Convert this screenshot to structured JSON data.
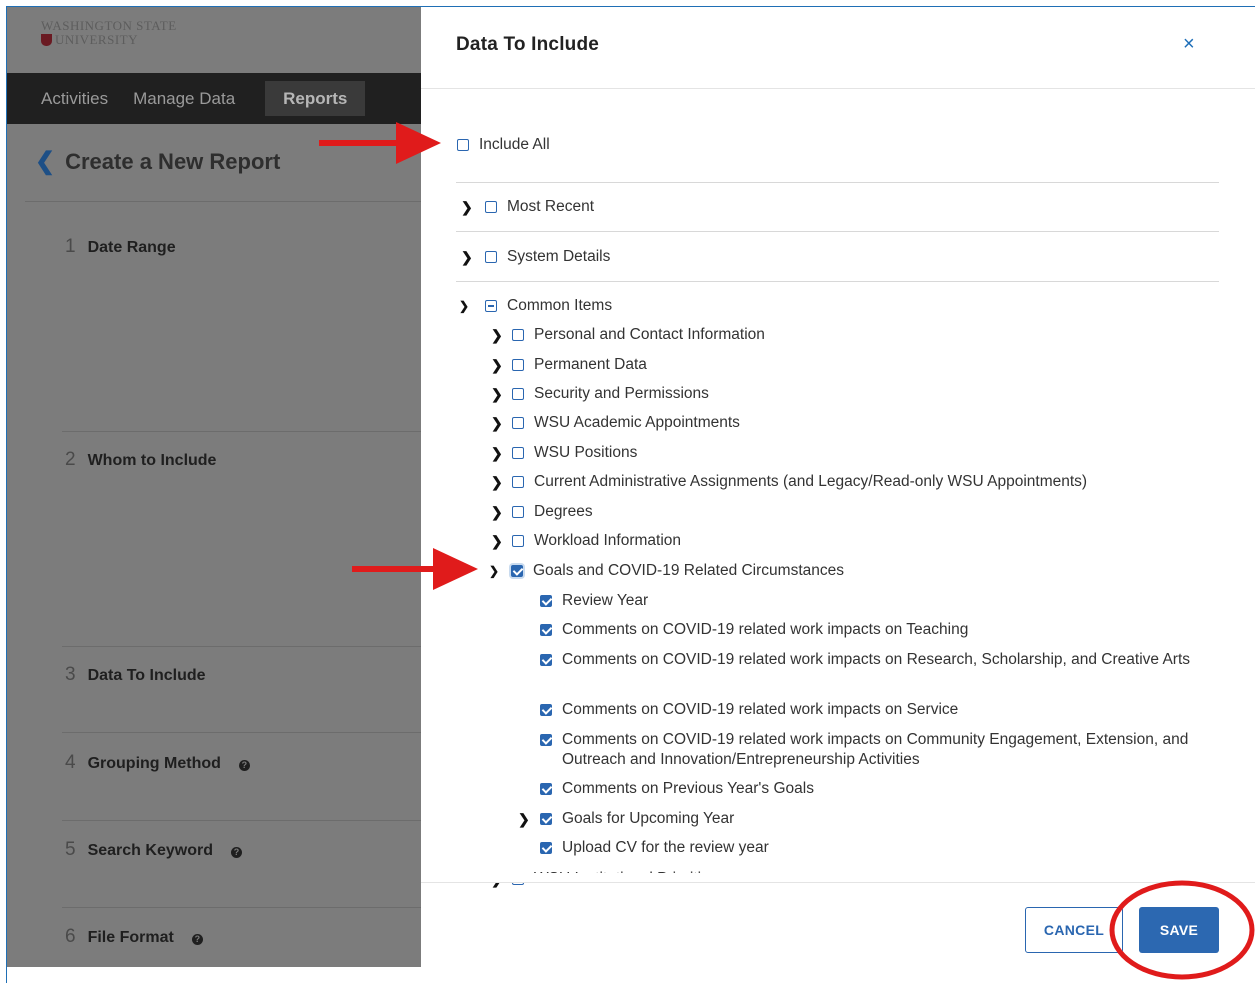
{
  "app": {
    "logo_line1": "WASHINGTON STATE",
    "logo_line2": "UNIVERSITY",
    "nav": [
      "Activities",
      "Manage Data",
      "Reports"
    ],
    "page_title": "Create a New Report",
    "steps": [
      {
        "num": "1",
        "label": "Date Range"
      },
      {
        "num": "2",
        "label": "Whom to Include"
      },
      {
        "num": "3",
        "label": "Data To Include"
      },
      {
        "num": "4",
        "label": "Grouping Method"
      },
      {
        "num": "5",
        "label": "Search Keyword"
      },
      {
        "num": "6",
        "label": "File Format"
      }
    ]
  },
  "dialog": {
    "title": "Data To Include",
    "close_label": "×",
    "include_all": "Include All",
    "sections": [
      {
        "label": "Most Recent",
        "expanded": false,
        "state": "unchecked"
      },
      {
        "label": "System Details",
        "expanded": false,
        "state": "unchecked"
      },
      {
        "label": "Common Items",
        "expanded": true,
        "state": "partial"
      }
    ],
    "common_items": [
      {
        "label": "Personal and Contact Information",
        "state": "unchecked"
      },
      {
        "label": "Permanent Data",
        "state": "unchecked"
      },
      {
        "label": "Security and Permissions",
        "state": "unchecked"
      },
      {
        "label": "WSU Academic Appointments",
        "state": "unchecked"
      },
      {
        "label": "WSU Positions",
        "state": "unchecked"
      },
      {
        "label": "Current Administrative Assignments (and Legacy/Read-only WSU Appointments)",
        "state": "unchecked"
      },
      {
        "label": "Degrees",
        "state": "unchecked"
      },
      {
        "label": "Workload Information",
        "state": "unchecked"
      },
      {
        "label": "Goals and COVID-19 Related Circumstances",
        "state": "checked",
        "expanded": true
      }
    ],
    "goals_items": [
      {
        "label": "Review Year",
        "state": "checked"
      },
      {
        "label": "Comments on COVID-19 related work impacts on Teaching",
        "state": "checked"
      },
      {
        "label": "Comments on COVID-19 related work impacts on Research, Scholarship, and Creative Arts",
        "state": "checked"
      },
      {
        "label": "Comments on COVID-19 related work impacts on Service",
        "state": "checked"
      },
      {
        "label": "Comments on COVID-19 related work impacts on Community Engagement, Extension, and Outreach and Innovation/Entrepreneurship Activities",
        "state": "checked"
      },
      {
        "label": "Comments on Previous Year's Goals",
        "state": "checked"
      },
      {
        "label": "Goals for Upcoming Year",
        "state": "checked",
        "has_children": true
      },
      {
        "label": "Upload CV for the review year",
        "state": "checked"
      }
    ],
    "partial_next_item": "WSU Institutional Priorities",
    "cancel_label": "CANCEL",
    "save_label": "SAVE"
  },
  "colors": {
    "accent": "#2a66b0",
    "annotation_red": "#e01b1b",
    "overlay": "#7c7c7c",
    "nav_bg": "#202020"
  }
}
